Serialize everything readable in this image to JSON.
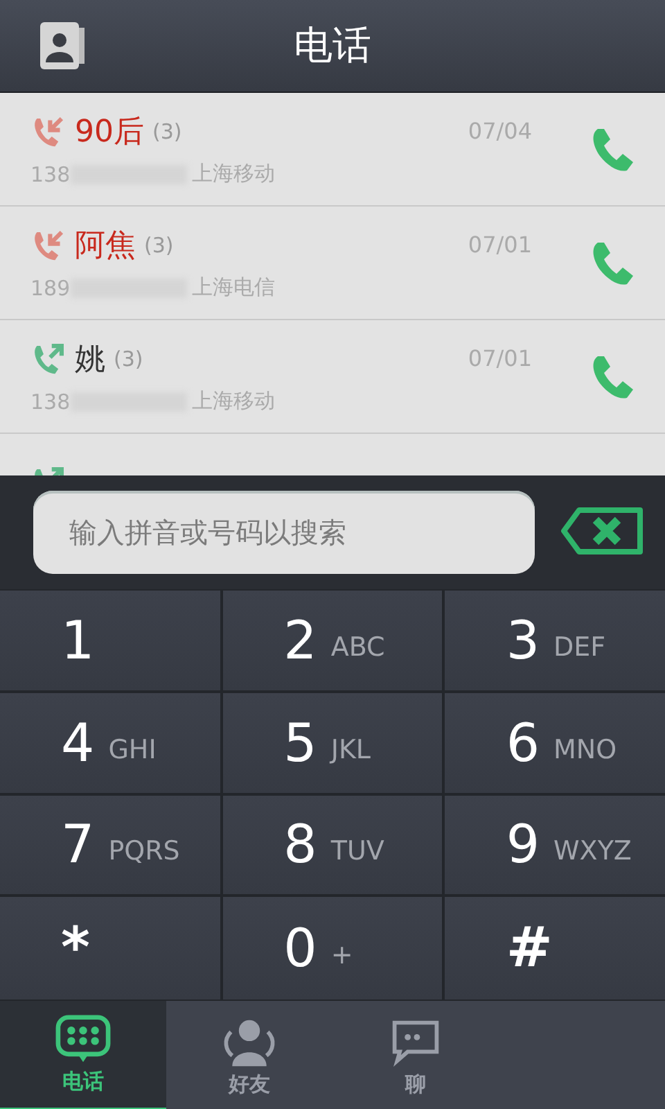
{
  "header": {
    "title": "电话"
  },
  "calls": [
    {
      "kind": "missed",
      "name": "90后",
      "count": "(3)",
      "number": "138",
      "carrier": "上海移动",
      "date": "07/04"
    },
    {
      "kind": "missed",
      "name": "阿焦",
      "count": "(3)",
      "number": "189",
      "carrier": "上海电信",
      "date": "07/01"
    },
    {
      "kind": "outgoing",
      "name": "姚",
      "count": "(3)",
      "number": "138",
      "carrier": "上海移动",
      "date": "07/01"
    },
    {
      "kind": "outgoing"
    }
  ],
  "search": {
    "placeholder": "输入拼音或号码以搜索"
  },
  "keypad": [
    {
      "digit": "1"
    },
    {
      "digit": "2",
      "letters": "ABC"
    },
    {
      "digit": "3",
      "letters": "DEF"
    },
    {
      "digit": "4",
      "letters": "GHI"
    },
    {
      "digit": "5",
      "letters": "JKL"
    },
    {
      "digit": "6",
      "letters": "MNO"
    },
    {
      "digit": "7",
      "letters": "PQRS"
    },
    {
      "digit": "8",
      "letters": "TUV"
    },
    {
      "digit": "9",
      "letters": "WXYZ"
    },
    {
      "digit": "*"
    },
    {
      "digit": "0",
      "letters": "+"
    },
    {
      "digit": "#"
    }
  ],
  "tabs": [
    {
      "kind": "dialer",
      "label": "电话",
      "selected": true
    },
    {
      "kind": "friends",
      "label": "好友",
      "selected": false
    },
    {
      "kind": "chat",
      "label": "聊",
      "selected": false
    }
  ]
}
